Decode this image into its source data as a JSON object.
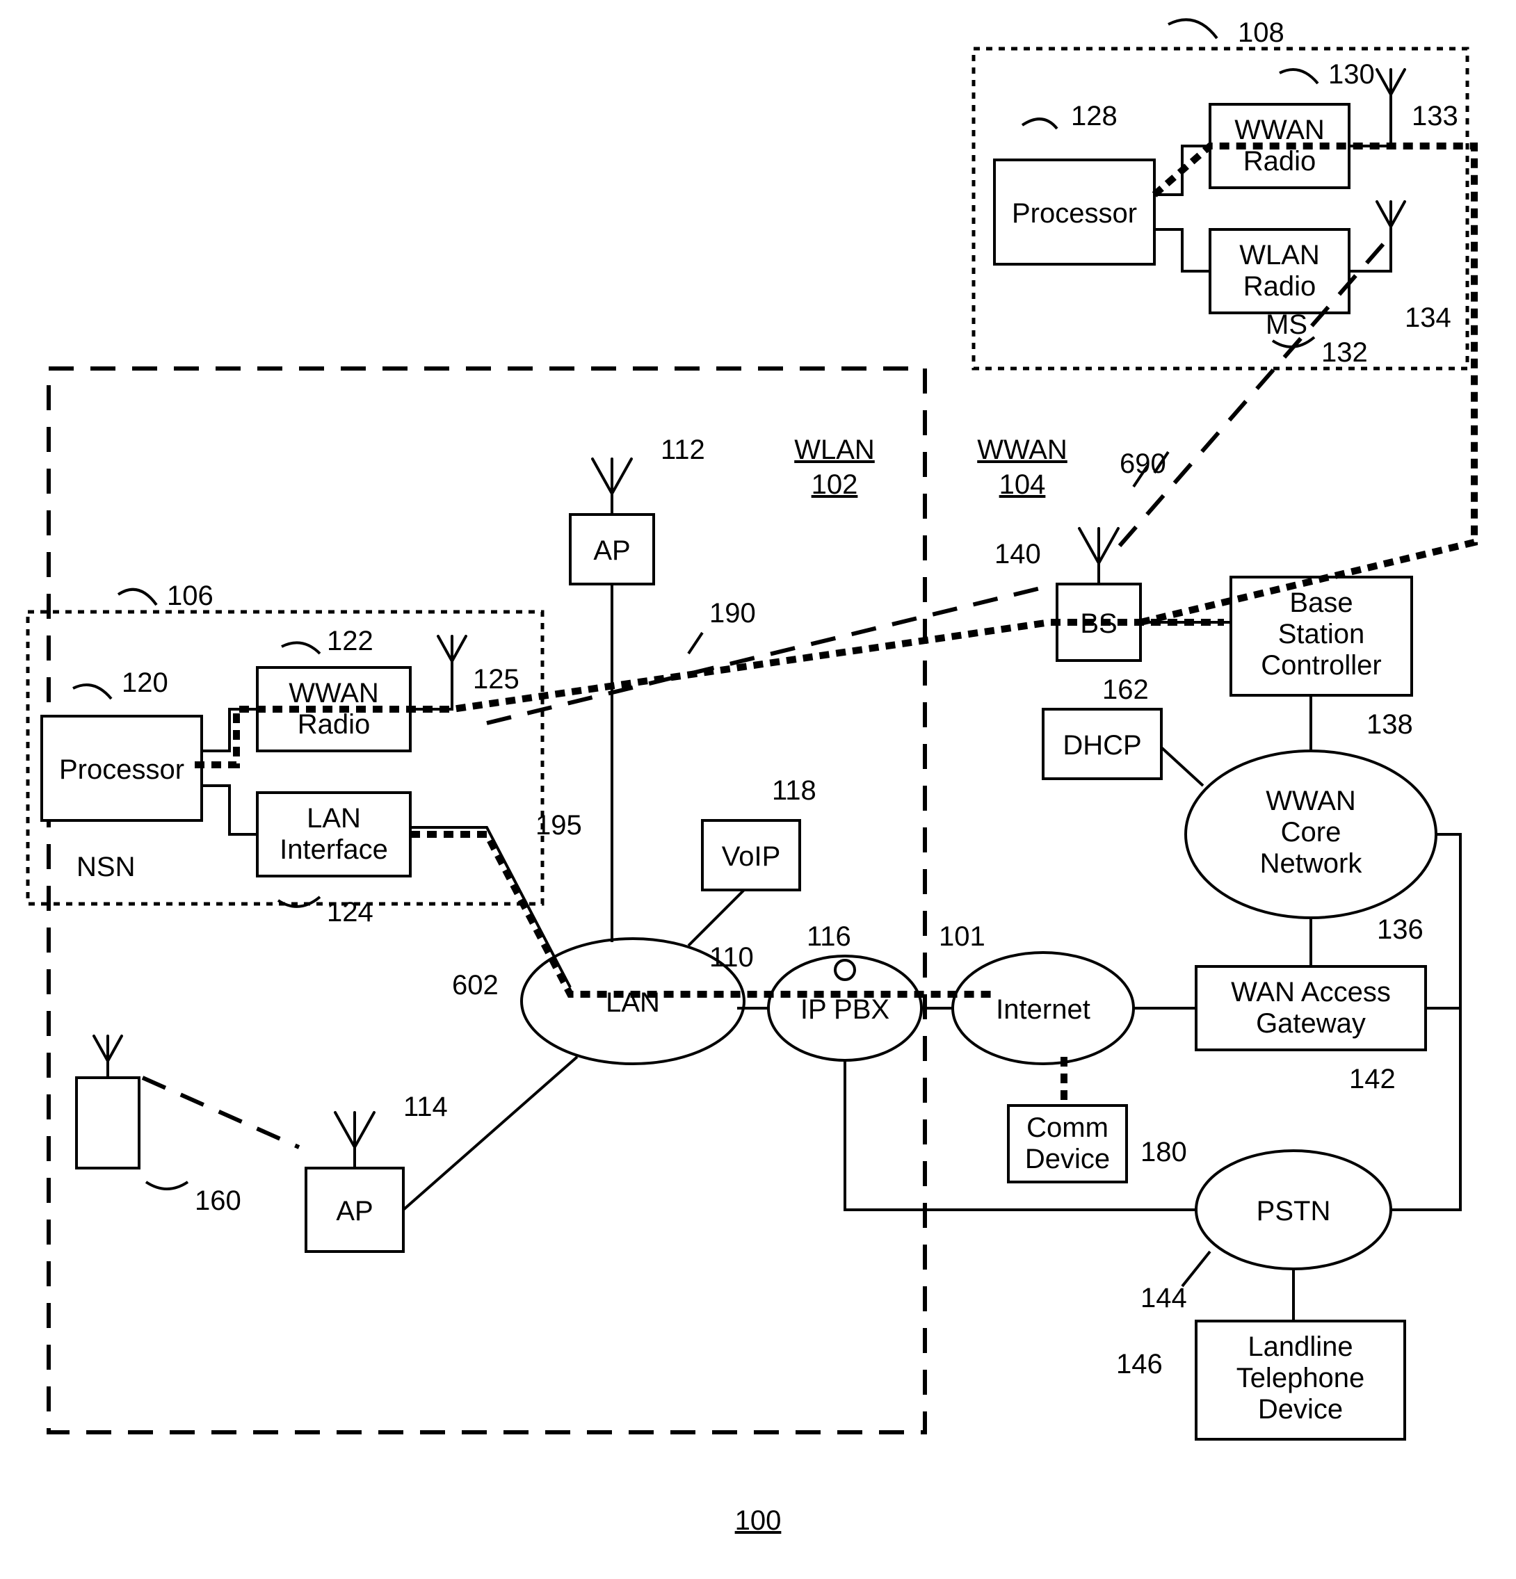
{
  "figure_number": "100",
  "msBox": {
    "label": "MS",
    "ref": "108",
    "processor": {
      "label": "Processor",
      "ref": "128"
    },
    "wwan": {
      "label": "WWAN\nRadio",
      "ref": "130",
      "antRef": "133"
    },
    "wlan": {
      "label": "WLAN\nRadio",
      "ref": "132",
      "antRef": "134"
    }
  },
  "nsnBox": {
    "label": "NSN",
    "ref": "106",
    "processor": {
      "label": "Processor",
      "ref": "120"
    },
    "wwan": {
      "label": "WWAN\nRadio",
      "ref": "122",
      "antRef": "125"
    },
    "lanif": {
      "label": "LAN\nInterface",
      "ref": "124"
    }
  },
  "wlan": {
    "label": "WLAN",
    "ref": "102",
    "ap1": {
      "label": "AP",
      "ref": "112"
    },
    "ap2": {
      "label": "AP",
      "ref": "114"
    }
  },
  "wwan": {
    "label": "WWAN",
    "ref": "104"
  },
  "lan": {
    "label": "LAN",
    "ref": "110"
  },
  "voip": {
    "label": "VoIP",
    "ref": "118"
  },
  "ippbx": {
    "label": "IP PBX",
    "ref": "116"
  },
  "internet": {
    "label": "Internet",
    "ref": "101"
  },
  "bs": {
    "label": "BS",
    "ref": "140"
  },
  "bsc": {
    "label": "Base\nStation\nController",
    "ref": "138"
  },
  "dhcp": {
    "label": "DHCP",
    "ref": "162"
  },
  "core": {
    "label": "WWAN\nCore\nNetwork",
    "ref": "136"
  },
  "wag": {
    "label": "WAN Access\nGateway",
    "ref": "142"
  },
  "comm": {
    "label": "Comm\nDevice",
    "ref": "180"
  },
  "pstn": {
    "label": "PSTN",
    "ref": "144"
  },
  "landline": {
    "label": "Landline\nTelephone\nDevice",
    "ref": "146"
  },
  "extDev": {
    "ref": "160"
  },
  "pathRefs": {
    "air190": "190",
    "lanPath195": "195",
    "wired602": "602",
    "air690": "690"
  }
}
